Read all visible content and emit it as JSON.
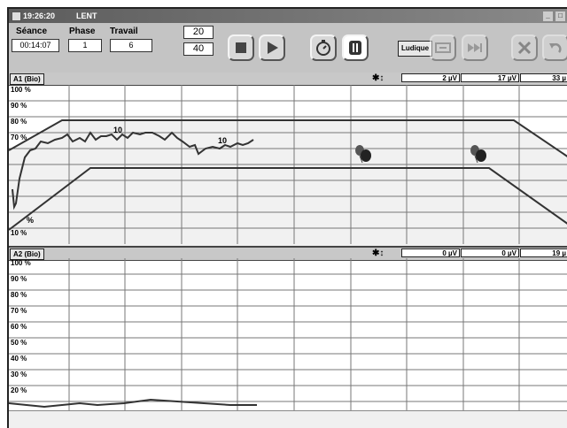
{
  "window": {
    "time": "19:26:20",
    "mode": "LENT",
    "controls": {
      "minimize": "_",
      "restore": "□"
    }
  },
  "toolbar": {
    "seance_label": "Séance",
    "phase_label": "Phase",
    "travail_label": "Travail",
    "seance_value": "00:14:07",
    "phase_value": "1",
    "travail_value": "6",
    "upper_value": "20",
    "lower_value": "40",
    "ludique_label": "Ludique",
    "buttons": [
      {
        "name": "stop-button",
        "icon": "stop-square-icon"
      },
      {
        "name": "play-button",
        "icon": "play-triangle-icon"
      },
      {
        "name": "timer-button",
        "icon": "stopwatch-icon"
      },
      {
        "name": "pause-button",
        "icon": "pause-icon"
      },
      {
        "name": "ludique-button",
        "icon": "text-label"
      },
      {
        "name": "skip-button",
        "icon": "skip-arrows-icon",
        "disabled": true
      },
      {
        "name": "next-button",
        "icon": "fast-forward-icon",
        "disabled": true
      },
      {
        "name": "cancel-button",
        "icon": "x-cancel-icon",
        "disabled": true
      },
      {
        "name": "back-button",
        "icon": "undo-icon",
        "disabled": true
      }
    ]
  },
  "panels": [
    {
      "channel": "A1 (Bio)",
      "readouts": [
        "2 µV",
        "17 µV",
        "33 µ"
      ],
      "ticks": [
        "100 %",
        "90 %",
        "80 %",
        "70 %",
        "10 %"
      ],
      "curve_labels": [
        "10",
        "10"
      ],
      "tiny_label": "% "
    },
    {
      "channel": "A2 (Bio)",
      "readouts": [
        "0 µV",
        "0 µV",
        "19 µ"
      ],
      "ticks": [
        "100 %",
        "90 %",
        "80 %",
        "70 %",
        "60 %",
        "50 %",
        "40 %",
        "30 %",
        "20 %"
      ]
    }
  ],
  "colors": {
    "toolbar_bg": "#c4c4c4",
    "panel_header_bg": "#c8c8c8",
    "grid": "#777777",
    "curve": "#333333",
    "corridor": "#f1f1f1"
  }
}
